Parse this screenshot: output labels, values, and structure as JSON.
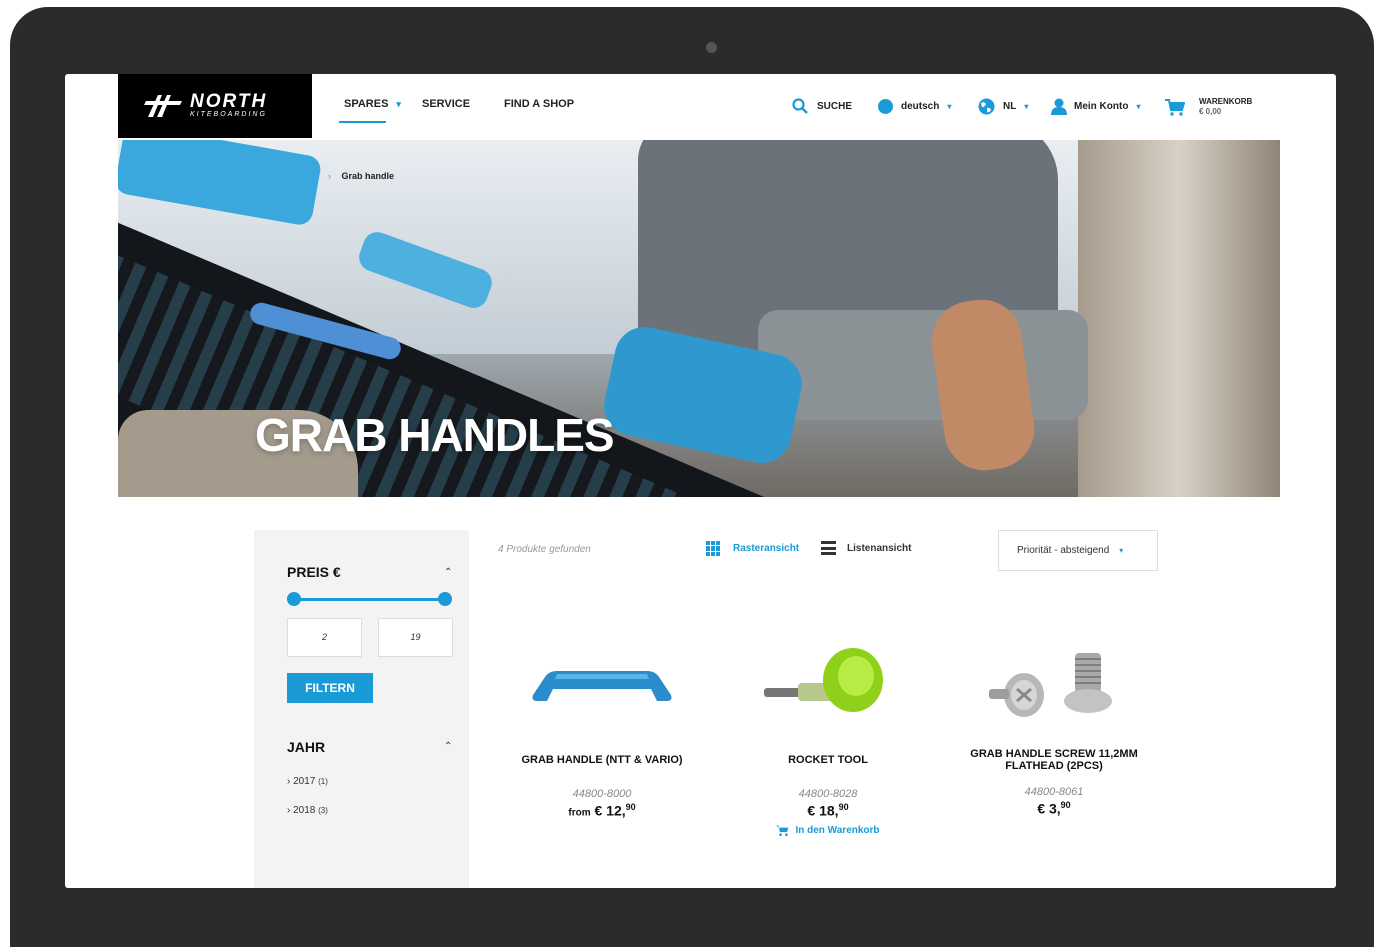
{
  "header": {
    "logo": {
      "brand": "NORTH",
      "sub": "KITEBOARDING"
    },
    "nav": [
      {
        "label": "SPARES",
        "has_caret": true
      },
      {
        "label": "SERVICE"
      },
      {
        "label": "FIND A SHOP"
      }
    ],
    "search_label": "SUCHE",
    "language": "deutsch",
    "country": "NL",
    "account": "Mein Konto",
    "cart_title": "WARENKORB",
    "cart_total": "€ 0,00"
  },
  "hero": {
    "breadcrumb_current": "Grab handle",
    "title": "GRAB HANDLES"
  },
  "sidebar": {
    "price_heading": "PREIS €",
    "price_min": "2",
    "price_max": "19",
    "filter_label": "FILTERN",
    "year_heading": "JAHR",
    "years": [
      {
        "label": "› 2017",
        "count": "(1)"
      },
      {
        "label": "› 2018",
        "count": "(3)"
      }
    ]
  },
  "listing": {
    "found_text": "4 Produkte gefunden",
    "grid_view_label": "Rasteransicht",
    "list_view_label": "Listenansicht",
    "sort_label": "Priorität - absteigend",
    "products": [
      {
        "name": "GRAB HANDLE (NTT & VARIO)",
        "sku": "44800-8000",
        "price_prefix": "from",
        "price_main": "€ 12,",
        "price_cents": "90"
      },
      {
        "name": "ROCKET TOOL",
        "sku": "44800-8028",
        "price_prefix": "",
        "price_main": "€ 18,",
        "price_cents": "90",
        "cart_label": "In den Warenkorb"
      },
      {
        "name": "GRAB HANDLE SCREW 11,2MM FLATHEAD (2PCS)",
        "sku": "44800-8061",
        "price_prefix": "",
        "price_main": "€ 3,",
        "price_cents": "90"
      }
    ]
  },
  "colors": {
    "accent": "#1a9ad6",
    "frame": "#2b2b2b",
    "sidebar_bg": "#f3f3f3"
  }
}
